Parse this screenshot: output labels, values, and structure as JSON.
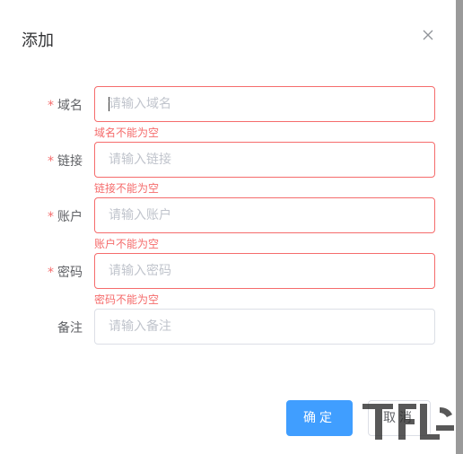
{
  "dialog": {
    "title": "添加",
    "close_icon": "close-icon"
  },
  "form": {
    "fields": [
      {
        "label": "域名",
        "required": true,
        "placeholder": "请输入域名",
        "error": "域名不能为空",
        "focused": true
      },
      {
        "label": "链接",
        "required": true,
        "placeholder": "请输入链接",
        "error": "链接不能为空"
      },
      {
        "label": "账户",
        "required": true,
        "placeholder": "请输入账户",
        "error": "账户不能为空"
      },
      {
        "label": "密码",
        "required": true,
        "placeholder": "请输入密码",
        "error": "密码不能为空"
      },
      {
        "label": "备注",
        "required": false,
        "placeholder": "请输入备注",
        "error": ""
      }
    ],
    "required_mark": "*"
  },
  "footer": {
    "confirm_label": "确定",
    "cancel_label": "取消"
  },
  "colors": {
    "primary": "#409eff",
    "error": "#f56c6c",
    "border": "#dcdfe6",
    "placeholder": "#c0c4cc"
  }
}
